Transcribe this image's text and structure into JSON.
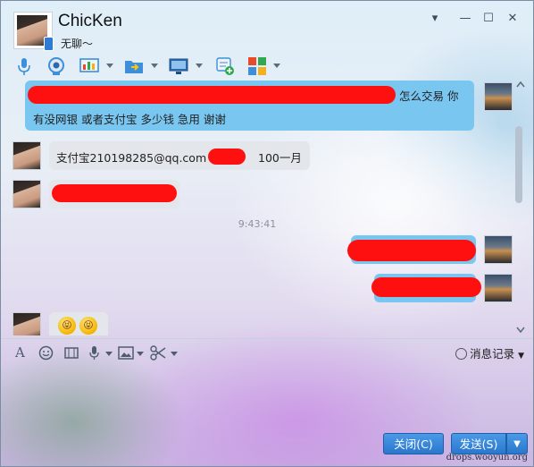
{
  "contact": {
    "name": "ChicKen",
    "status": "无聊～"
  },
  "window": {
    "minimize": "▾",
    "restore": "—",
    "maximize": "☐",
    "close": "✕"
  },
  "toolbar_icons": [
    "microphone-icon",
    "video-camera-icon",
    "screen-share-icon",
    "file-transfer-icon",
    "remote-desktop-icon",
    "group-chat-icon",
    "apps-icon"
  ],
  "messages": [
    {
      "side": "right",
      "text_visible": "怎么交易 你",
      "text_line2": "有没网银 或者支付宝 多少钱 急用 谢谢",
      "redacted": true
    },
    {
      "side": "left",
      "text_prefix": "支付宝210198285@qq.com",
      "text_suffix": "100一月",
      "redacted": true
    },
    {
      "side": "left",
      "redacted": true
    },
    {
      "side": "right",
      "redacted": true
    },
    {
      "side": "right",
      "redacted": true
    },
    {
      "side": "left",
      "emojis": [
        "😝",
        "😝"
      ]
    }
  ],
  "timestamp": "9:43:41",
  "input_toolbar": {
    "font": "A",
    "history_label": "消息记录"
  },
  "buttons": {
    "close": "关闭(C)",
    "send": "发送(S)"
  },
  "watermark": "drops.wooyun.org",
  "colors": {
    "bubble_blue": "#79c6f1",
    "bubble_gray": "#e3e6ea",
    "button_blue": "#2a77cc",
    "redaction": "#ff1010"
  }
}
